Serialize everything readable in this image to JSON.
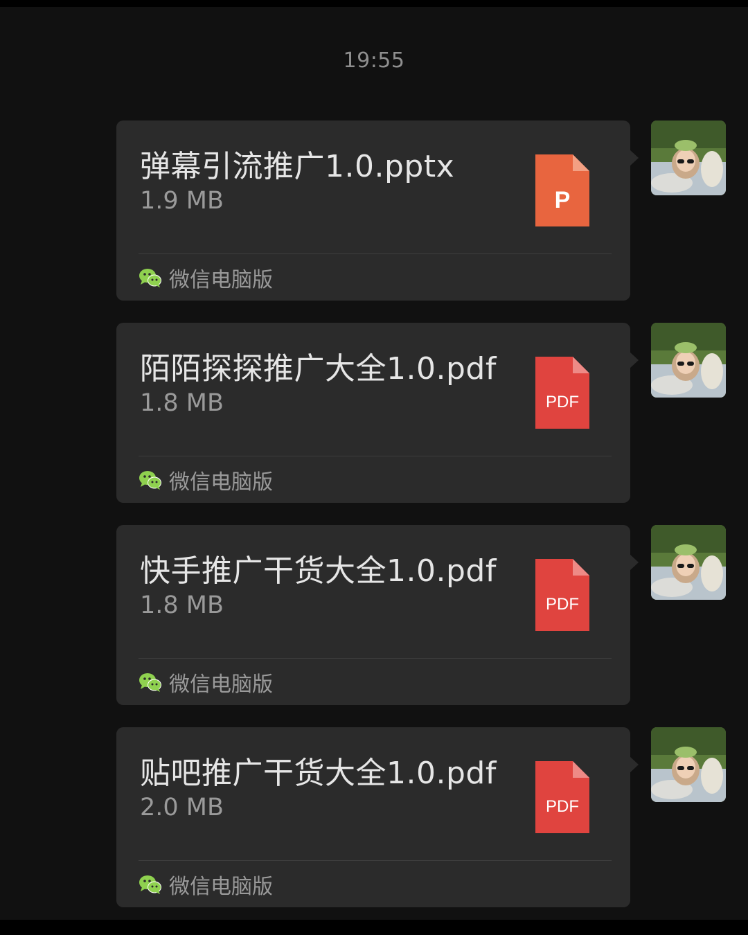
{
  "chat": {
    "timestamp": "19:55",
    "messages": [
      {
        "file_name": "弹幕引流推广1.0.pptx",
        "file_size": "1.9 MB",
        "file_type": "pptx",
        "icon_label": "P",
        "icon_color": "#e8653f",
        "source_app": "微信电脑版"
      },
      {
        "file_name": "陌陌探探推广大全1.0.pdf",
        "file_size": "1.8 MB",
        "file_type": "pdf",
        "icon_label": "PDF",
        "icon_color": "#e0443f",
        "source_app": "微信电脑版"
      },
      {
        "file_name": "快手推广干货大全1.0.pdf",
        "file_size": "1.8 MB",
        "file_type": "pdf",
        "icon_label": "PDF",
        "icon_color": "#e0443f",
        "source_app": "微信电脑版"
      },
      {
        "file_name": "贴吧推广干货大全1.0.pdf",
        "file_size": "2.0 MB",
        "file_type": "pdf",
        "icon_label": "PDF",
        "icon_color": "#e0443f",
        "source_app": "微信电脑版"
      }
    ]
  },
  "colors": {
    "background": "#111111",
    "bubble": "#2b2b2b",
    "wechat_green": "#8fd14f"
  }
}
